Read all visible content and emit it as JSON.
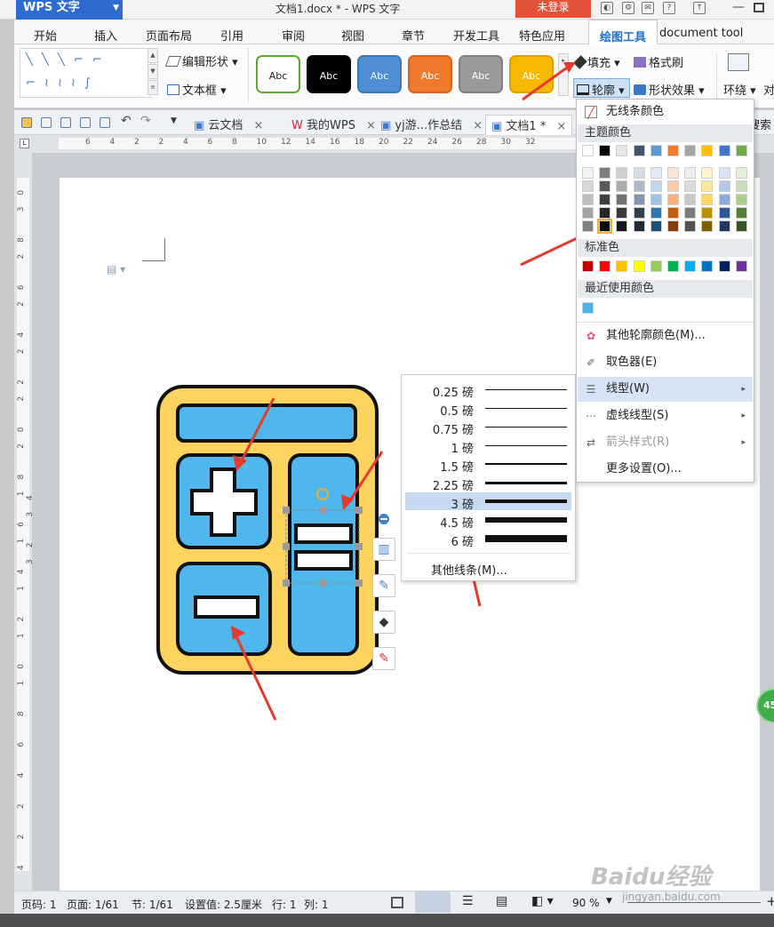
{
  "app": {
    "logo": "WPS 文字",
    "title": "文档1.docx * - WPS 文字",
    "login": "未登录"
  },
  "menu_tabs": [
    "开始",
    "插入",
    "页面布局",
    "引用",
    "审阅",
    "视图",
    "章节",
    "开发工具",
    "特色应用",
    "绘图工具",
    "document tool"
  ],
  "active_tab": "绘图工具",
  "ribbon": {
    "edit_shape": "编辑形状",
    "text_box": "文本框",
    "style_swatches": [
      {
        "label": "Abc",
        "fill": "#ffffff",
        "border": "#5aa83a",
        "text": "#222222"
      },
      {
        "label": "Abc",
        "fill": "#000000",
        "border": "#000000",
        "text": "#ffffff"
      },
      {
        "label": "Abc",
        "fill": "#4d8fd2",
        "border": "#3a78b8",
        "text": "#ffffff"
      },
      {
        "label": "Abc",
        "fill": "#ef7a2b",
        "border": "#d8661a",
        "text": "#ffffff"
      },
      {
        "label": "Abc",
        "fill": "#9a9a9a",
        "border": "#808080",
        "text": "#ffffff"
      },
      {
        "label": "Abc",
        "fill": "#f6b800",
        "border": "#dba300",
        "text": "#ffffff"
      }
    ],
    "fill": "填充",
    "format_painter": "格式刷",
    "outline": "轮廓",
    "shape_effects": "形状效果",
    "wrap": "环绕",
    "align": "对"
  },
  "doc_tabs": [
    {
      "label": "云文档",
      "active": false
    },
    {
      "label": "我的WPS",
      "active": false
    },
    {
      "label": "yj游...作总结",
      "active": false
    },
    {
      "label": "文档1 *",
      "active": true
    }
  ],
  "search_fragment": "搜索",
  "ruler_numbers": [
    "6",
    "4",
    "2",
    "2",
    "4",
    "6",
    "8",
    "10",
    "12",
    "14",
    "16",
    "18",
    "20",
    "22",
    "24",
    "26",
    "28",
    "30",
    "32"
  ],
  "vruler_numbers": "4 2 2 4 6 8 10 12 14 16 18 20 22 24 26 28 30 32 34",
  "outline_menu": {
    "no_line": "无线条颜色",
    "theme_colors_heading": "主题颜色",
    "theme_top_row": [
      "#ffffff",
      "#000000",
      "#e7e6e6",
      "#44546a",
      "#5b9bd5",
      "#ed7d31",
      "#a5a5a5",
      "#ffc000",
      "#4472c4",
      "#70ad47"
    ],
    "theme_grid": [
      [
        "#f2f2f2",
        "#7f7f7f",
        "#d0cece",
        "#d6dce4",
        "#deebf6",
        "#fbe5d5",
        "#ededed",
        "#fff2cc",
        "#dae3f3",
        "#e2efd9"
      ],
      [
        "#d8d8d8",
        "#595959",
        "#aeabab",
        "#adb9ca",
        "#bdd7ee",
        "#f8cbad",
        "#dbdbdb",
        "#fee599",
        "#b4c7e7",
        "#c5e0b3"
      ],
      [
        "#bfbfbf",
        "#3f3f3f",
        "#757070",
        "#8496b0",
        "#9dc3e6",
        "#f4b183",
        "#c9c9c9",
        "#ffd966",
        "#8faadc",
        "#a8d08d"
      ],
      [
        "#a5a5a5",
        "#262626",
        "#3a3838",
        "#323f4f",
        "#2e75b5",
        "#c55a11",
        "#7b7b7b",
        "#bf9000",
        "#2f5597",
        "#538135"
      ],
      [
        "#7f7f7f",
        "#0d0d0d",
        "#171616",
        "#222a35",
        "#1e4e79",
        "#843c0b",
        "#525252",
        "#7f6000",
        "#203864",
        "#375623"
      ]
    ],
    "standard_colors_heading": "标准色",
    "standard_colors": [
      "#c00000",
      "#ff0000",
      "#ffc000",
      "#ffff00",
      "#92d050",
      "#00b050",
      "#00b0f0",
      "#0070c0",
      "#002060",
      "#7030a0"
    ],
    "recent_heading": "最近使用颜色",
    "recent_colors": [
      "#4fb3e8"
    ],
    "items": [
      {
        "label": "其他轮廓颜色(M)...",
        "icon": "palette-icon",
        "submenu": false,
        "disabled": false
      },
      {
        "label": "取色器(E)",
        "icon": "eyedropper-icon",
        "submenu": false,
        "disabled": false
      },
      {
        "label": "线型(W)",
        "icon": "line-style-icon",
        "submenu": true,
        "disabled": false
      },
      {
        "label": "虚线线型(S)",
        "icon": "dash-style-icon",
        "submenu": true,
        "disabled": false
      },
      {
        "label": "箭头样式(R)",
        "icon": "arrow-style-icon",
        "submenu": true,
        "disabled": true
      },
      {
        "label": "更多设置(O)...",
        "icon": "",
        "submenu": false,
        "disabled": false
      }
    ]
  },
  "line_weights": [
    {
      "label": "0.25 磅",
      "pt": 0.25
    },
    {
      "label": "0.5 磅",
      "pt": 0.5
    },
    {
      "label": "0.75 磅",
      "pt": 0.75
    },
    {
      "label": "1 磅",
      "pt": 1
    },
    {
      "label": "1.5 磅",
      "pt": 1.5
    },
    {
      "label": "2.25 磅",
      "pt": 2.25
    },
    {
      "label": "3 磅",
      "pt": 3
    },
    {
      "label": "4.5 磅",
      "pt": 4.5
    },
    {
      "label": "6 磅",
      "pt": 6
    }
  ],
  "selected_weight": "3 磅",
  "more_lines": "其他线条(M)...",
  "status": {
    "page": "页码: 1",
    "pages": "页面: 1/61",
    "section": "节: 1/61",
    "setting": "设置值: 2.5厘米",
    "row": "行: 1",
    "col": "列: 1",
    "zoom": "90 %"
  },
  "calculator_colors": {
    "body": "#fbd35e",
    "key": "#4fb7ec",
    "outline": "#111111",
    "arrow": "#e53a2e"
  },
  "bubble": "45",
  "watermark": "Baidu经验",
  "watermark_url": "jingyan.baidu.com"
}
